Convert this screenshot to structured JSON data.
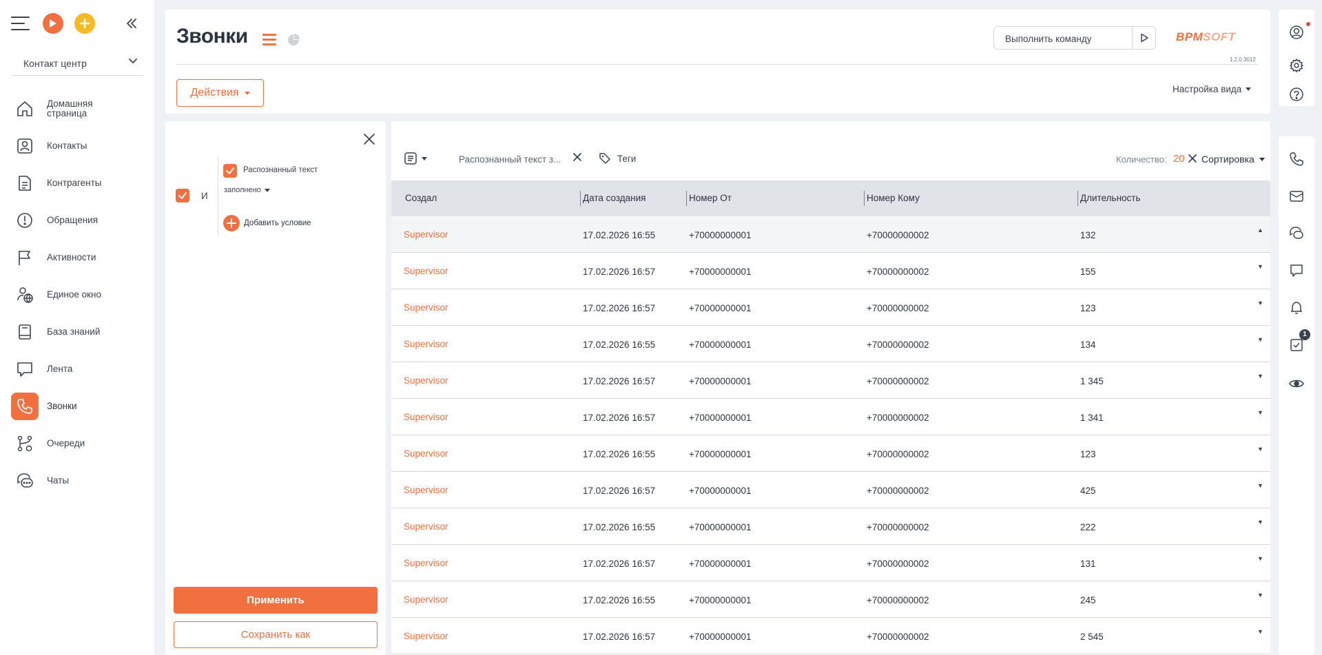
{
  "app": {
    "workspace": "Контакт центр",
    "page_title": "Звонки",
    "command_placeholder": "Выполнить команду",
    "logo_b": "BPM",
    "logo_s": "SOFT",
    "version": "1.2.0.3012",
    "actions_label": "Действия",
    "view_settings_label": "Настройка вида",
    "accent_color": "#f26f3f"
  },
  "sidebar": {
    "items": [
      {
        "label": "Домашняя страница",
        "icon": "home-icon"
      },
      {
        "label": "Контакты",
        "icon": "contact-icon"
      },
      {
        "label": "Контрагенты",
        "icon": "document-icon"
      },
      {
        "label": "Обращения",
        "icon": "alert-icon"
      },
      {
        "label": "Активности",
        "icon": "flag-icon"
      },
      {
        "label": "Единое окно",
        "icon": "user-globe-icon"
      },
      {
        "label": "База знаний",
        "icon": "book-icon"
      },
      {
        "label": "Лента",
        "icon": "chat-bubble-icon"
      },
      {
        "label": "Звонки",
        "icon": "phone-icon",
        "active": true
      },
      {
        "label": "Очереди",
        "icon": "queue-icon"
      },
      {
        "label": "Чаты",
        "icon": "chats-icon"
      }
    ]
  },
  "filter": {
    "group_operator": "И",
    "condition_label": "Распознанный текст",
    "condition_operator": "заполнено",
    "add_condition_label": "Добавить условие",
    "apply_label": "Применить",
    "save_as_label": "Сохранить как"
  },
  "toolbar": {
    "filter_chip": "Распознанный текст з...",
    "tags_label": "Теги",
    "count_label": "Количество:",
    "count_value": "20",
    "sort_label": "Сортировка"
  },
  "table": {
    "columns": [
      "Создал",
      "Дата создания",
      "Номер От",
      "Номер Кому",
      "Длительность"
    ],
    "rows": [
      {
        "created_by": "Supervisor",
        "date": "17.02.2026 16:55",
        "from": "+70000000001",
        "to": "+70000000002",
        "duration": "132",
        "expanded": true
      },
      {
        "created_by": "Supervisor",
        "date": "17.02.2026 16:57",
        "from": "+70000000001",
        "to": "+70000000002",
        "duration": "155"
      },
      {
        "created_by": "Supervisor",
        "date": "17.02.2026 16:57",
        "from": "+70000000001",
        "to": "+70000000002",
        "duration": "123"
      },
      {
        "created_by": "Supervisor",
        "date": "17.02.2026 16:55",
        "from": "+70000000001",
        "to": "+70000000002",
        "duration": "134"
      },
      {
        "created_by": "Supervisor",
        "date": "17.02.2026 16:57",
        "from": "+70000000001",
        "to": "+70000000002",
        "duration": "1 345"
      },
      {
        "created_by": "Supervisor",
        "date": "17.02.2026 16:57",
        "from": "+70000000001",
        "to": "+70000000002",
        "duration": "1 341"
      },
      {
        "created_by": "Supervisor",
        "date": "17.02.2026 16:55",
        "from": "+70000000001",
        "to": "+70000000002",
        "duration": "123"
      },
      {
        "created_by": "Supervisor",
        "date": "17.02.2026 16:57",
        "from": "+70000000001",
        "to": "+70000000002",
        "duration": "425"
      },
      {
        "created_by": "Supervisor",
        "date": "17.02.2026 16:55",
        "from": "+70000000001",
        "to": "+70000000002",
        "duration": "222"
      },
      {
        "created_by": "Supervisor",
        "date": "17.02.2026 16:57",
        "from": "+70000000001",
        "to": "+70000000002",
        "duration": "131"
      },
      {
        "created_by": "Supervisor",
        "date": "17.02.2026 16:55",
        "from": "+70000000001",
        "to": "+70000000002",
        "duration": "245"
      },
      {
        "created_by": "Supervisor",
        "date": "17.02.2026 16:57",
        "from": "+70000000001",
        "to": "+70000000002",
        "duration": "2 545"
      }
    ]
  },
  "rail": {
    "tasks_badge": "1",
    "icons": [
      "profile-icon",
      "settings-icon",
      "help-icon",
      "phone-icon",
      "mail-icon",
      "chats-icon",
      "message-icon",
      "bell-icon",
      "tasks-icon",
      "eye-icon"
    ]
  }
}
